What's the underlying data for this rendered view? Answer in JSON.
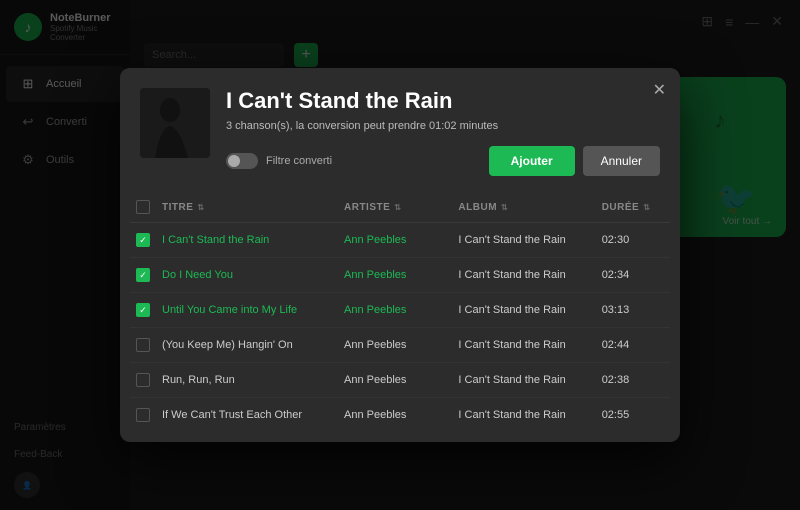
{
  "app": {
    "name": "NoteBurner",
    "subtitle": "Spotify Music Converter"
  },
  "sidebar": {
    "items": [
      {
        "id": "accueil",
        "label": "Accueil",
        "icon": "⊞",
        "active": true
      },
      {
        "id": "converti",
        "label": "Converti",
        "icon": "↩",
        "active": false
      },
      {
        "id": "outils",
        "label": "Outils",
        "icon": "⚙",
        "active": false
      }
    ],
    "bottom": [
      {
        "id": "parametres",
        "label": "Paramètres"
      },
      {
        "id": "feedback",
        "label": "Feed-Back"
      }
    ]
  },
  "modal": {
    "title": "I Can't Stand the Rain",
    "subtitle": "3 chanson(s), la conversion peut prendre 01:02 minutes",
    "filter_label": "Filtre converti",
    "btn_add": "Ajouter",
    "btn_cancel": "Annuler",
    "table": {
      "headers": [
        {
          "key": "cb",
          "label": ""
        },
        {
          "key": "titre",
          "label": "TITRE"
        },
        {
          "key": "artiste",
          "label": "ARTISTE"
        },
        {
          "key": "album",
          "label": "ALBUM"
        },
        {
          "key": "duree",
          "label": "DURÉE"
        }
      ],
      "rows": [
        {
          "checked": true,
          "titre": "I Can't Stand the Rain",
          "artiste": "Ann Peebles",
          "album": "I Can't Stand the Rain",
          "duree": "02:30"
        },
        {
          "checked": true,
          "titre": "Do I Need You",
          "artiste": "Ann Peebles",
          "album": "I Can't Stand the Rain",
          "duree": "02:34"
        },
        {
          "checked": true,
          "titre": "Until You Came into My Life",
          "artiste": "Ann Peebles",
          "album": "I Can't Stand the Rain",
          "duree": "03:13"
        },
        {
          "checked": false,
          "titre": "(You Keep Me) Hangin' On",
          "artiste": "Ann Peebles",
          "album": "I Can't Stand the Rain",
          "duree": "02:44"
        },
        {
          "checked": false,
          "titre": "Run, Run, Run",
          "artiste": "Ann Peebles",
          "album": "I Can't Stand the Rain",
          "duree": "02:38"
        },
        {
          "checked": false,
          "titre": "If We Can't Trust Each Other",
          "artiste": "Ann Peebles",
          "album": "I Can't Stand the Rain",
          "duree": "02:55"
        }
      ]
    }
  },
  "topbar": {
    "voir_tout": "Voir tout →"
  }
}
